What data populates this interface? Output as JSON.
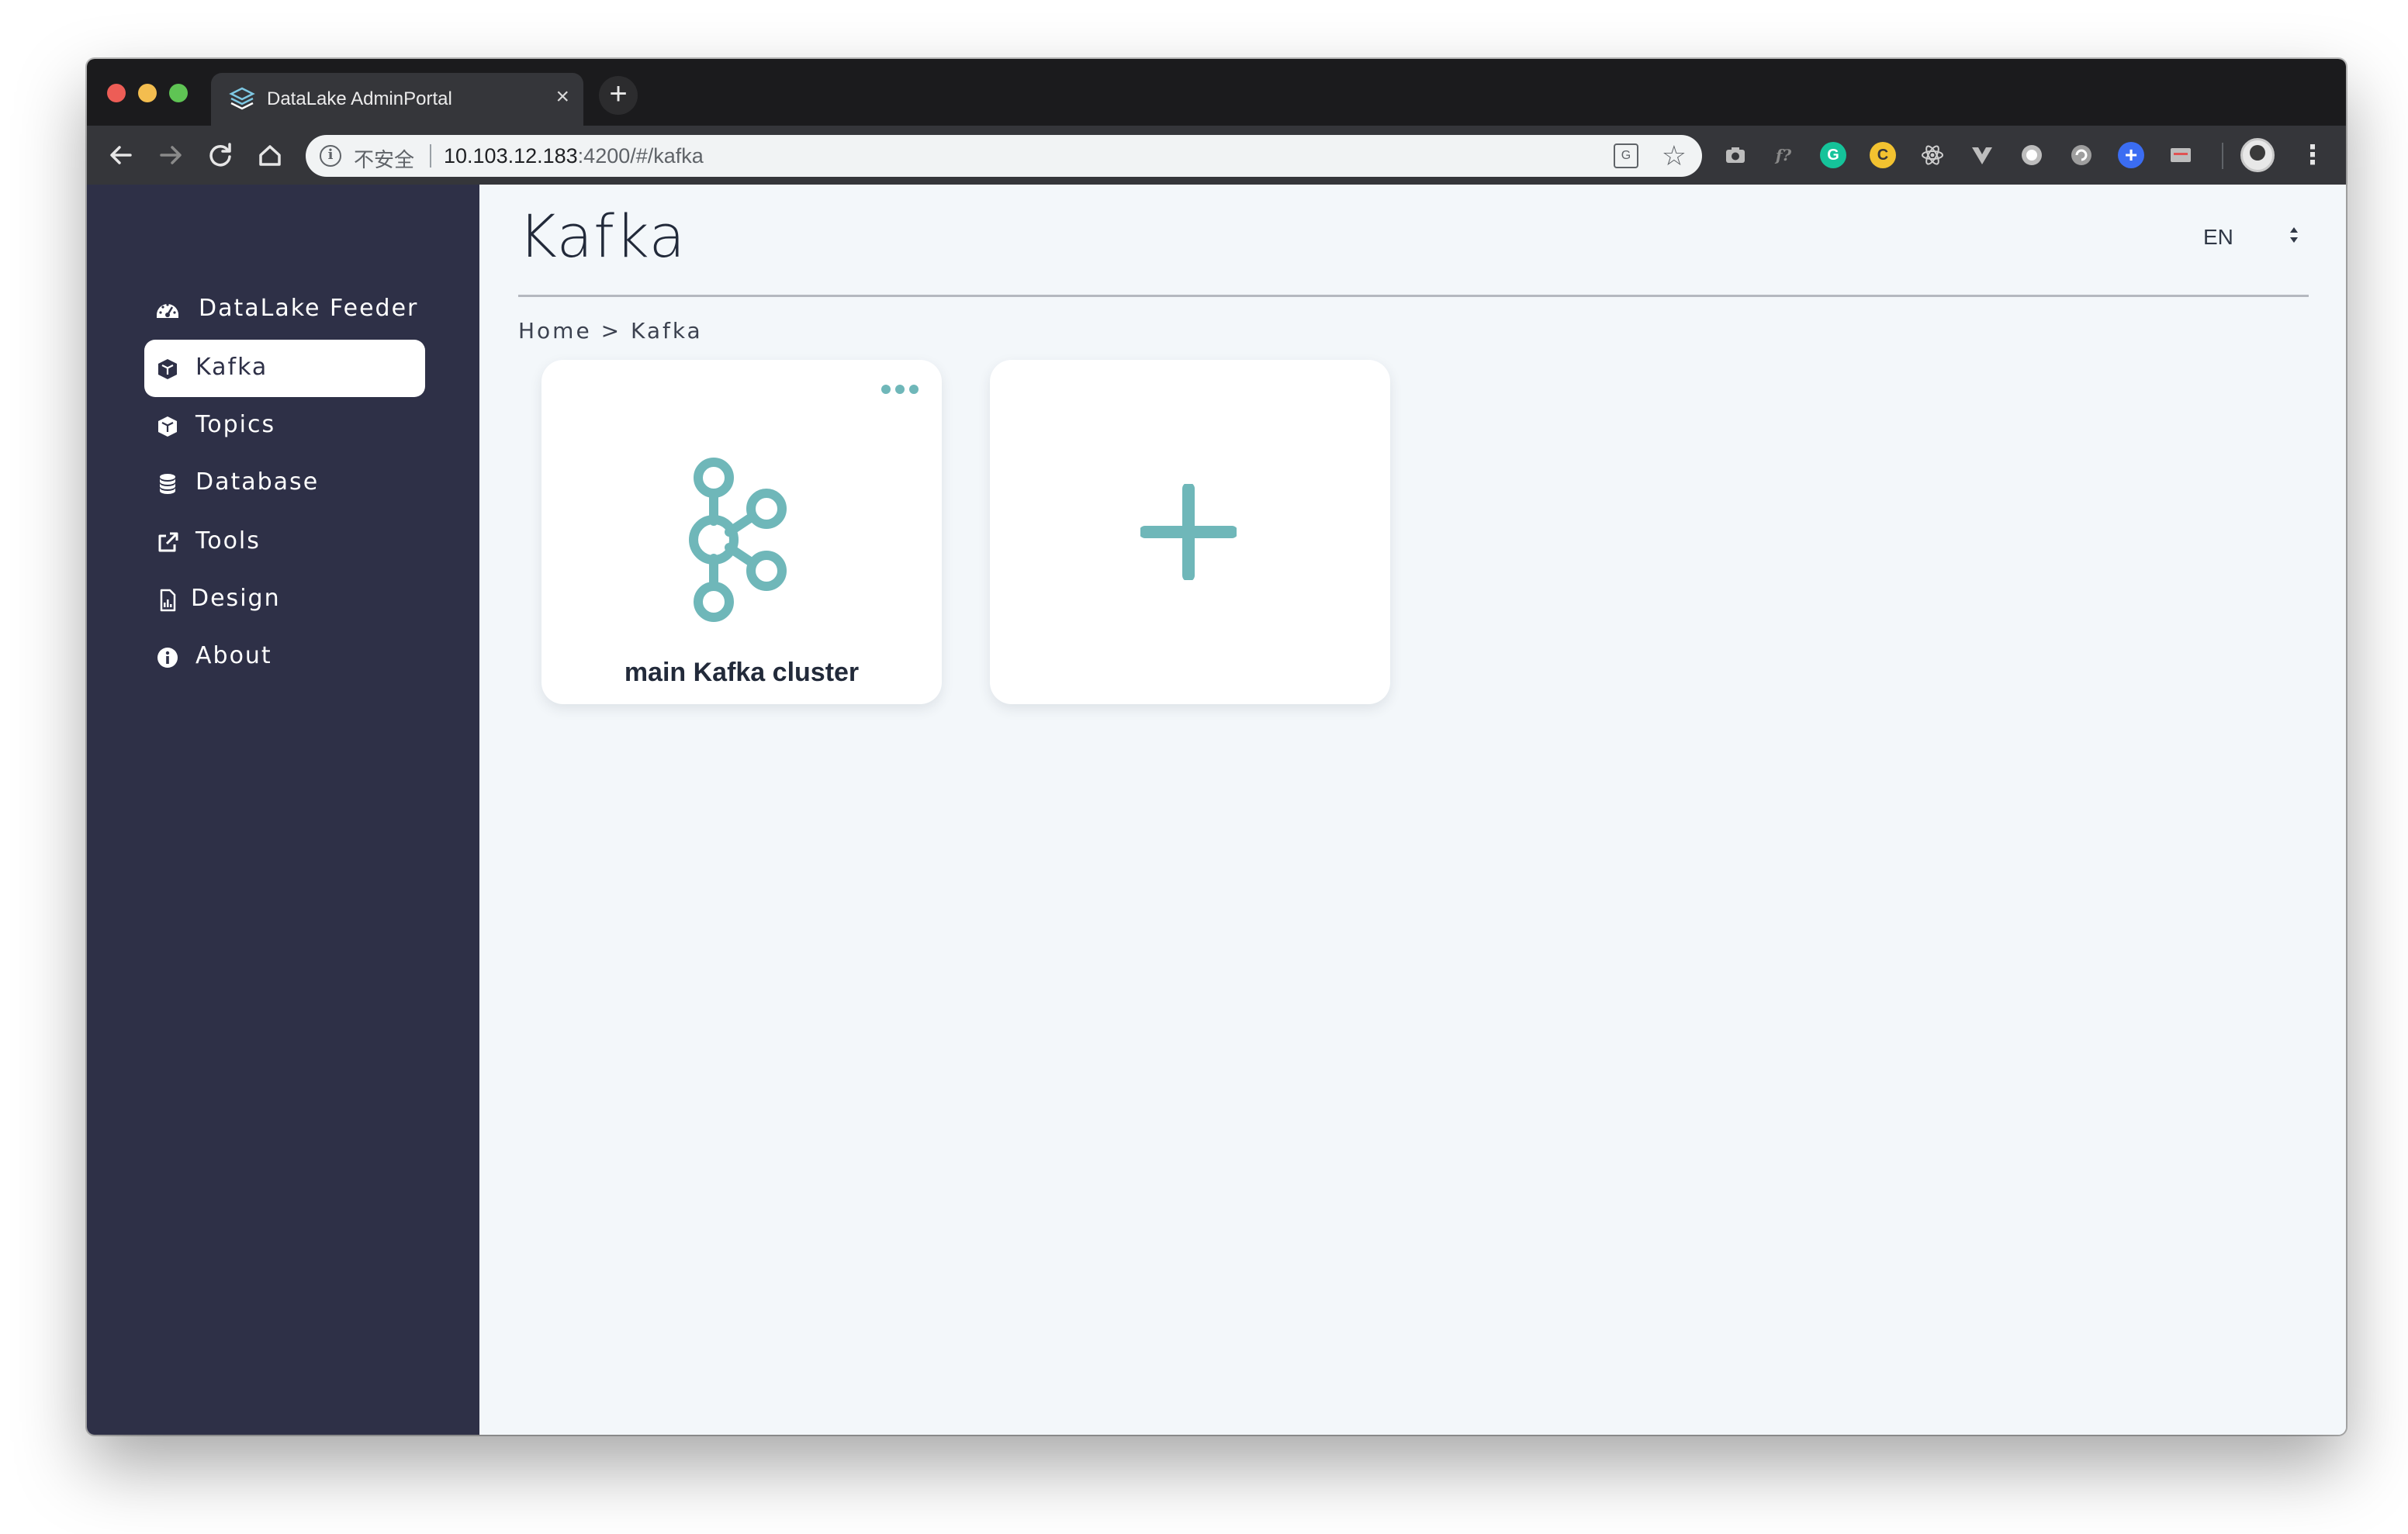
{
  "browser": {
    "tab_title": "DataLake AdminPortal",
    "tab_close": "×",
    "new_tab": "+",
    "security_label": "不安全",
    "url_host": "10.103.12.183",
    "url_path": ":4200/#/kafka"
  },
  "sidebar": {
    "items": [
      {
        "label": "DataLake Feeder",
        "icon": "gauge-icon"
      },
      {
        "label": "Kafka",
        "icon": "cube-icon",
        "active": true
      },
      {
        "label": "Topics",
        "icon": "cube-icon"
      },
      {
        "label": "Database",
        "icon": "database-icon"
      },
      {
        "label": "Tools",
        "icon": "external-link-icon"
      },
      {
        "label": "Design",
        "icon": "file-chart-icon"
      },
      {
        "label": "About",
        "icon": "info-icon"
      }
    ]
  },
  "header": {
    "title": "Kafka",
    "language": "EN"
  },
  "breadcrumb": "Home > Kafka",
  "cards": [
    {
      "label": "main Kafka cluster",
      "icon": "kafka-logo-icon"
    },
    {
      "label": "",
      "icon": "plus-icon"
    }
  ],
  "colors": {
    "sidebar_bg": "#2e3047",
    "accent_teal": "#6fb7b9",
    "content_bg": "#f3f7fa"
  }
}
